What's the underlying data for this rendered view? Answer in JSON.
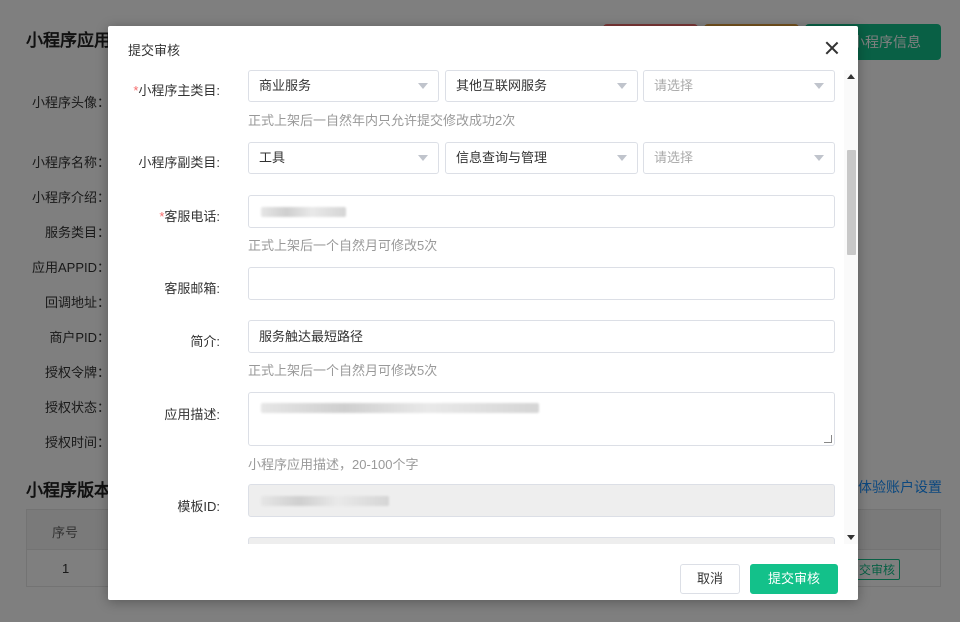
{
  "background": {
    "page_title": "小程序应用",
    "button_label": "小程序信息",
    "fields": [
      "小程序头像：",
      "小程序名称：",
      "小程序介绍：",
      "服务类目：",
      "应用APPID：",
      "回调地址：",
      "商户PID：",
      "授权令牌：",
      "授权状态：",
      "授权时间："
    ],
    "section_title": "小程序版本",
    "link": "体验账户设置",
    "table_header": "序号",
    "table_cell": "1",
    "row_action": "交审核"
  },
  "modal": {
    "title": "提交审核",
    "main_category": {
      "label": "小程序主类目:",
      "options": [
        "商业服务",
        "其他互联网服务",
        "请选择"
      ],
      "hint": "正式上架后一自然年内只允许提交修改成功2次"
    },
    "sub_category": {
      "label": "小程序副类目:",
      "options": [
        "工具",
        "信息查询与管理",
        "请选择"
      ]
    },
    "phone": {
      "label": "客服电话:",
      "hint": "正式上架后一个自然月可修改5次"
    },
    "email": {
      "label": "客服邮箱:",
      "value": ""
    },
    "intro": {
      "label": "简介:",
      "value": "服务触达最短路径",
      "hint": "正式上架后一个自然月可修改5次"
    },
    "description": {
      "label": "应用描述:",
      "hint": "小程序应用描述，20-100个字"
    },
    "template_id": {
      "label": "模板ID:"
    },
    "footer": {
      "cancel": "取消",
      "submit": "提交审核"
    }
  }
}
